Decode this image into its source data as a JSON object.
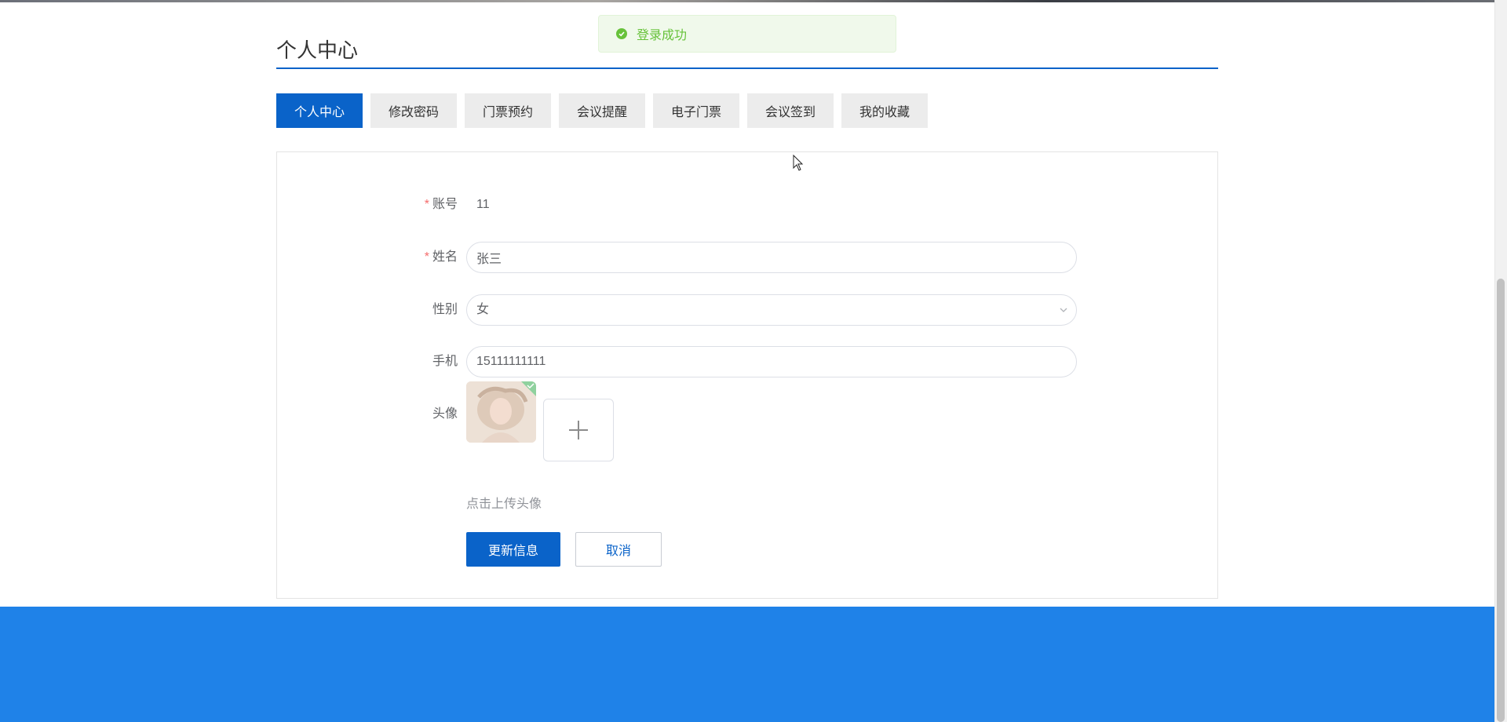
{
  "toast": {
    "message": "登录成功",
    "color": "#67c23a"
  },
  "page": {
    "title": "个人中心"
  },
  "tabs": [
    {
      "label": "个人中心",
      "active": true
    },
    {
      "label": "修改密码",
      "active": false
    },
    {
      "label": "门票预约",
      "active": false
    },
    {
      "label": "会议提醒",
      "active": false
    },
    {
      "label": "电子门票",
      "active": false
    },
    {
      "label": "会议签到",
      "active": false
    },
    {
      "label": "我的收藏",
      "active": false
    }
  ],
  "form": {
    "account": {
      "label": "账号",
      "required_mark": "*",
      "value": "11"
    },
    "name": {
      "label": "姓名",
      "required_mark": "*",
      "value": "张三"
    },
    "gender": {
      "label": "性别",
      "value": "女"
    },
    "phone": {
      "label": "手机",
      "value": "15111111111"
    },
    "avatar": {
      "label": "头像",
      "hint": "点击上传头像"
    }
  },
  "buttons": {
    "update": "更新信息",
    "cancel": "取消"
  },
  "colors": {
    "primary": "#0a63c9",
    "footer": "#1f82e8",
    "tab_inactive": "#ececec"
  }
}
